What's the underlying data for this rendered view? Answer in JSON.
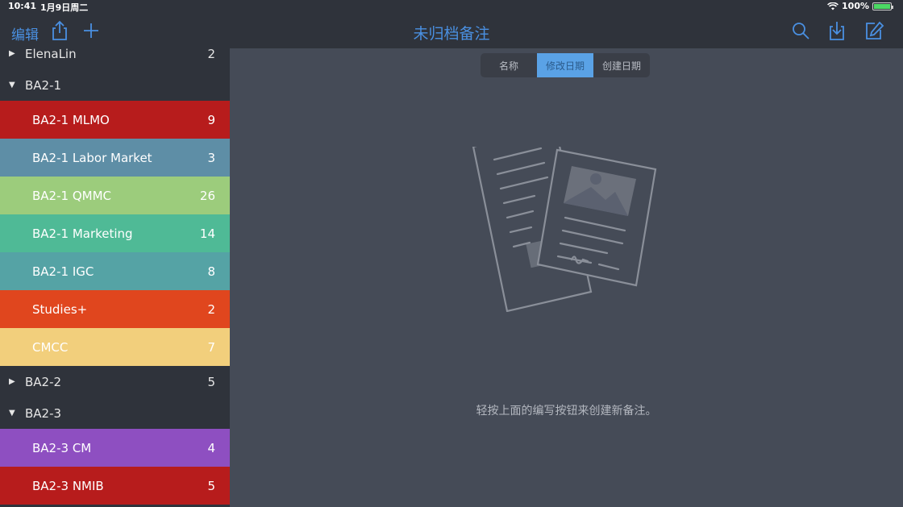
{
  "status": {
    "time": "10:41",
    "date": "1月9日周二",
    "battery": "100%"
  },
  "toolbar": {
    "edit_label": "编辑",
    "title": "未归档备注"
  },
  "sidebar": {
    "items": [
      {
        "type": "group",
        "label": "ElenaLin",
        "count": "2",
        "expanded": false
      },
      {
        "type": "group",
        "label": "BA2-1",
        "count": "",
        "expanded": true
      },
      {
        "type": "notebook",
        "label": "BA2-1 MLMO",
        "count": "9",
        "color": "#b71c1c"
      },
      {
        "type": "notebook",
        "label": "BA2-1 Labor Market",
        "count": "3",
        "color": "#5e8ea6"
      },
      {
        "type": "notebook",
        "label": "BA2-1 QMMC",
        "count": "26",
        "color": "#9ccc7c"
      },
      {
        "type": "notebook",
        "label": "BA2-1 Marketing",
        "count": "14",
        "color": "#4fba96"
      },
      {
        "type": "notebook",
        "label": "BA2-1 IGC",
        "count": "8",
        "color": "#55a3a5"
      },
      {
        "type": "notebook",
        "label": "Studies+",
        "count": "2",
        "color": "#e0461e"
      },
      {
        "type": "notebook",
        "label": "CMCC",
        "count": "7",
        "color": "#f2cf7c"
      },
      {
        "type": "group",
        "label": "BA2-2",
        "count": "5",
        "expanded": false
      },
      {
        "type": "group",
        "label": "BA2-3",
        "count": "",
        "expanded": true
      },
      {
        "type": "notebook",
        "label": "BA2-3 CM",
        "count": "4",
        "color": "#8e4fc1"
      },
      {
        "type": "notebook",
        "label": "BA2-3 NMIB",
        "count": "5",
        "color": "#b71c1c"
      }
    ]
  },
  "sort": {
    "options": [
      "名称",
      "修改日期",
      "创建日期"
    ],
    "selected": "修改日期"
  },
  "empty_hint": "轻按上面的编写按钮来创建新备注。",
  "colors": {
    "accent": "#4a90e2",
    "sidebar_bg": "#2f333b",
    "content_bg": "#454b57"
  }
}
